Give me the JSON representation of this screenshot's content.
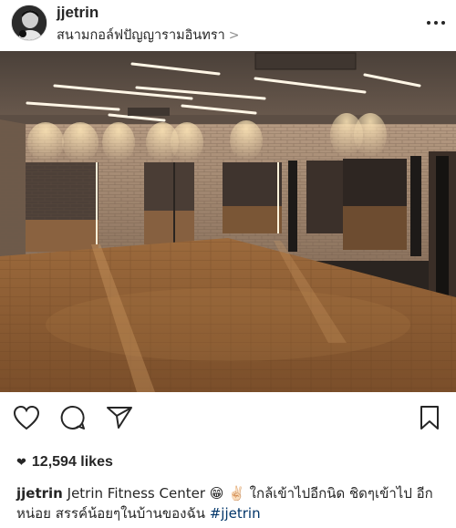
{
  "post": {
    "username": "jjetrin",
    "location": "สนามกอล์ฟปัญญารามอินทรา",
    "location_chevron": ">",
    "likes_text": "12,594 likes",
    "caption": {
      "username": "jjetrin",
      "text_line1": "Jetrin Fitness Center",
      "emoji1": "😁",
      "emoji2": "✌🏻",
      "thai_line1": "ใกล้เข้าไปอีกนิด ชิดๆเข้าไป",
      "thai_line2": "อีกหน่อย สรรค์น้อยๆในบ้านของฉัน",
      "hashtag": "#jjetrin"
    }
  },
  "icons": {
    "more": "more-dots-icon",
    "like": "heart-icon",
    "comment": "comment-icon",
    "share": "send-icon",
    "save": "bookmark-icon",
    "likes_heart": "heart-filled-icon"
  },
  "colors": {
    "text": "#262626",
    "hashtag": "#003569",
    "secondary": "#8e8e8e"
  }
}
